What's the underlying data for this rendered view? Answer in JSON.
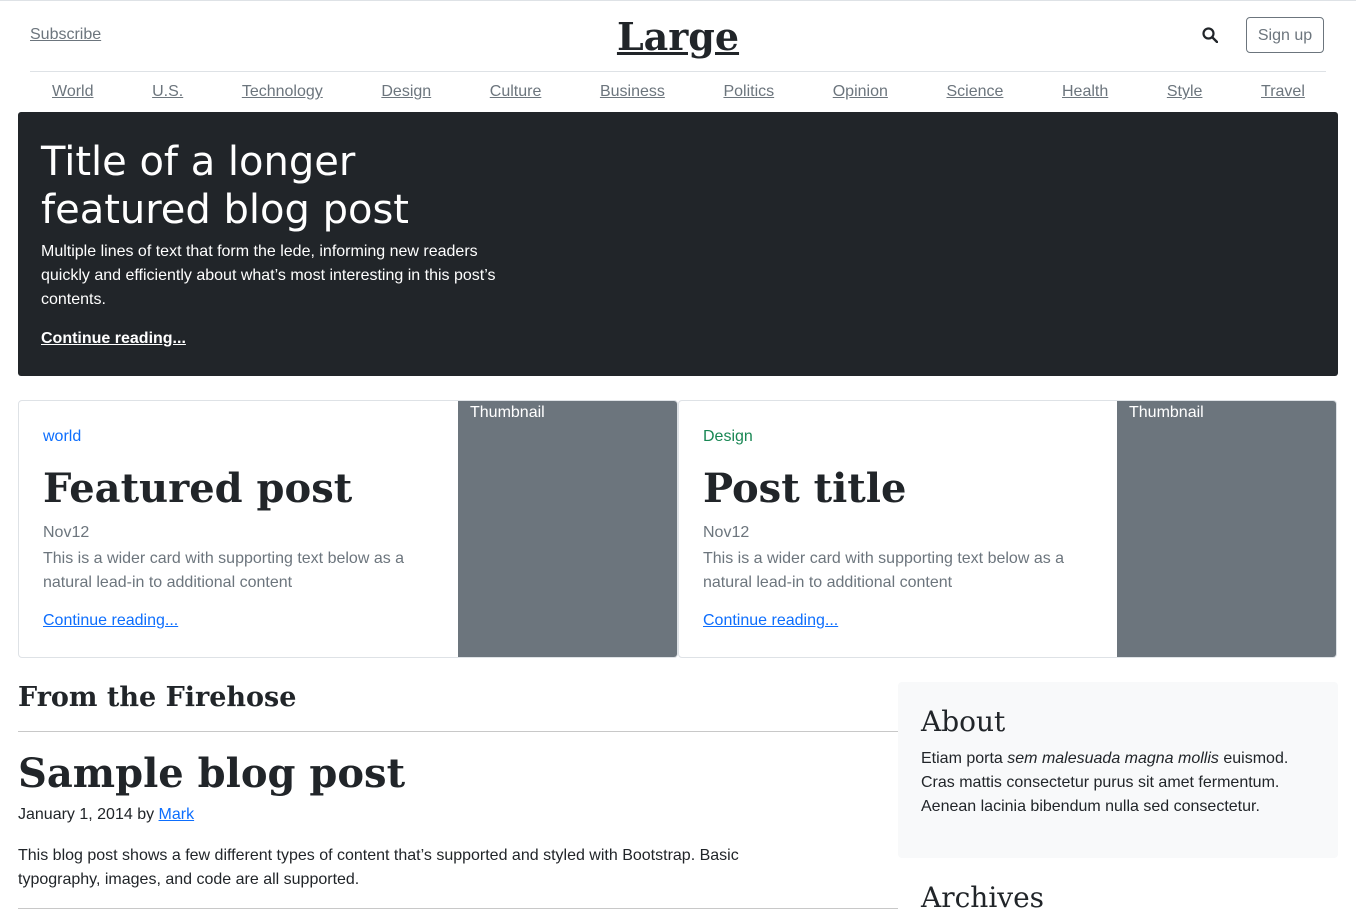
{
  "header": {
    "subscribe_label": "Subscribe",
    "logo": "Large",
    "search_icon": "search-icon",
    "signup_label": "Sign up"
  },
  "nav": {
    "items": [
      "World",
      "U.S.",
      "Technology",
      "Design",
      "Culture",
      "Business",
      "Politics",
      "Opinion",
      "Science",
      "Health",
      "Style",
      "Travel"
    ]
  },
  "hero": {
    "title": "Title of a longer featured blog post",
    "lede": "Multiple lines of text that form the lede, informing new readers quickly and efficiently about what’s most interesting in this post’s contents.",
    "link": "Continue reading..."
  },
  "cards": [
    {
      "category": "world",
      "category_color": "#0d6efd",
      "title": "Featured post",
      "date": "Nov12",
      "text": "This is a wider card with supporting text below as a natural lead-in to additional content",
      "link": "Continue reading...",
      "thumbnail_label": "Thumbnail"
    },
    {
      "category": "Design",
      "category_color": "#198754",
      "title": "Post title",
      "date": "Nov12",
      "text": "This is a wider card with supporting text below as a natural lead-in to additional content",
      "link": "Continue reading...",
      "thumbnail_label": "Thumbnail"
    }
  ],
  "main": {
    "section_title": "From the Firehose",
    "post": {
      "title": "Sample blog post",
      "meta_prefix": "January 1, 2014 by ",
      "author": "Mark",
      "body": "This blog post shows a few different types of content that’s supported and styled with Bootstrap. Basic typography, images, and code are all supported."
    }
  },
  "sidebar": {
    "about_title": "About",
    "about_text_1": "Etiam porta ",
    "about_text_em": "sem malesuada magna mollis",
    "about_text_2": " euismod. Cras mattis consectetur purus sit amet fermentum. Aenean lacinia bibendum nulla sed consectetur.",
    "archives_title": "Archives"
  },
  "colors": {
    "dark": "#212529",
    "muted": "#6c757d",
    "link": "#0d6efd",
    "sidebar_bg": "#f8f9fa"
  }
}
